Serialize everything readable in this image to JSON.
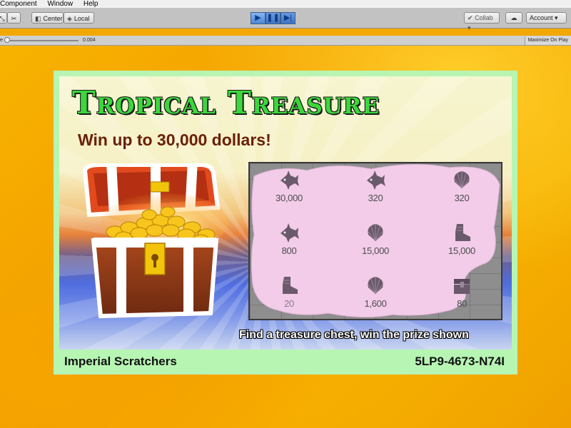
{
  "menu": {
    "items": [
      "Component",
      "Window",
      "Help"
    ]
  },
  "toolbar": {
    "pivot_label": "Center",
    "space_label": "Local",
    "play_buttons": [
      "play",
      "pause",
      "step"
    ],
    "collab_label": "Collab",
    "account_label": "Account"
  },
  "gamebar": {
    "scale_label": "e",
    "scale_value": "0.004",
    "maximize_label": "Maximize On Play"
  },
  "card": {
    "title": "Tropical Treasure",
    "subtitle": "Win up to 30,000 dollars!",
    "instruction": "Find a treasure chest, win the prize shown",
    "brand": "Imperial Scratchers",
    "ticket_code": "5LP9-4673-N74I"
  },
  "scratch": {
    "cells": [
      {
        "icon": "angelfish-icon",
        "value": "30,000"
      },
      {
        "icon": "angelfish-icon",
        "value": "320"
      },
      {
        "icon": "seashell-icon",
        "value": "320"
      },
      {
        "icon": "angelfish-icon",
        "value": "800"
      },
      {
        "icon": "seashell-icon",
        "value": "15,000"
      },
      {
        "icon": "boot-icon",
        "value": "15,000"
      },
      {
        "icon": "boot-icon",
        "value": "20"
      },
      {
        "icon": "seashell-icon",
        "value": "1,600"
      },
      {
        "icon": "treasure-chest-icon",
        "value": "80"
      }
    ],
    "scratch_color": "#f2cce8"
  }
}
